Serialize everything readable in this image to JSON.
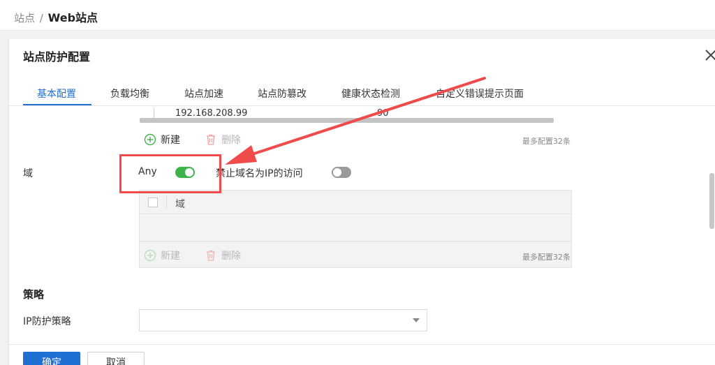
{
  "breadcrumb": {
    "parent": "站点",
    "separator": "/",
    "current": "Web站点"
  },
  "dialog": {
    "title": "站点防护配置",
    "tabs": [
      {
        "label": "基本配置",
        "active": true
      },
      {
        "label": "负载均衡"
      },
      {
        "label": "站点加速"
      },
      {
        "label": "站点防篡改"
      },
      {
        "label": "健康状态检测"
      },
      {
        "label": "自定义错误提示页面"
      }
    ]
  },
  "servers": {
    "row_ip": "192.168.208.99",
    "row_weight": "90",
    "add_label": "新建",
    "delete_label": "删除",
    "limit_text": "最多配置32条"
  },
  "domain": {
    "label": "域",
    "any_label": "Any",
    "any_enabled": true,
    "ban_ip_label": "禁止域名为IP的访问",
    "ban_ip_enabled": false,
    "table_header": "域",
    "add_label": "新建",
    "delete_label": "删除",
    "limit_text": "最多配置32条"
  },
  "policy": {
    "section_title": "策略",
    "ip_label": "IP防护策略",
    "ip_value": ""
  },
  "footer": {
    "confirm_label": "确定",
    "cancel_label": "取消"
  },
  "colors": {
    "primary": "#1f6fd4",
    "toggle_on": "#3bb54a",
    "annotation": "#ef4b4b"
  }
}
